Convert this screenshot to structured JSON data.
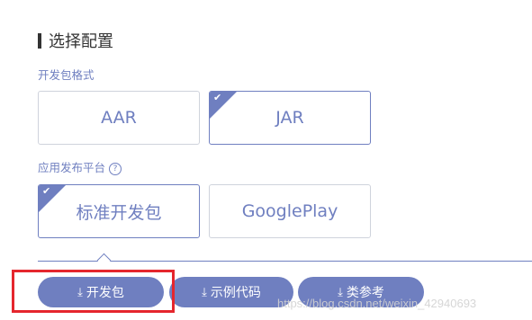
{
  "section": {
    "title": "选择配置"
  },
  "package_format": {
    "label": "开发包格式",
    "options": [
      {
        "label": "AAR",
        "selected": false
      },
      {
        "label": "JAR",
        "selected": true
      }
    ]
  },
  "platform": {
    "label": "应用发布平台",
    "help_icon": "?",
    "options": [
      {
        "label": "标准开发包",
        "selected": true
      },
      {
        "label": "GooglePlay",
        "selected": false
      }
    ]
  },
  "check_glyph": "✔",
  "download_glyph": "⤓",
  "buttons": {
    "dev_package": "开发包",
    "sample_code": "示例代码",
    "reference": "类参考"
  },
  "watermark": "https://blog.csdn.net/weixin_42940693",
  "colors": {
    "accent": "#6f7fc0",
    "highlight": "#e5262d"
  }
}
